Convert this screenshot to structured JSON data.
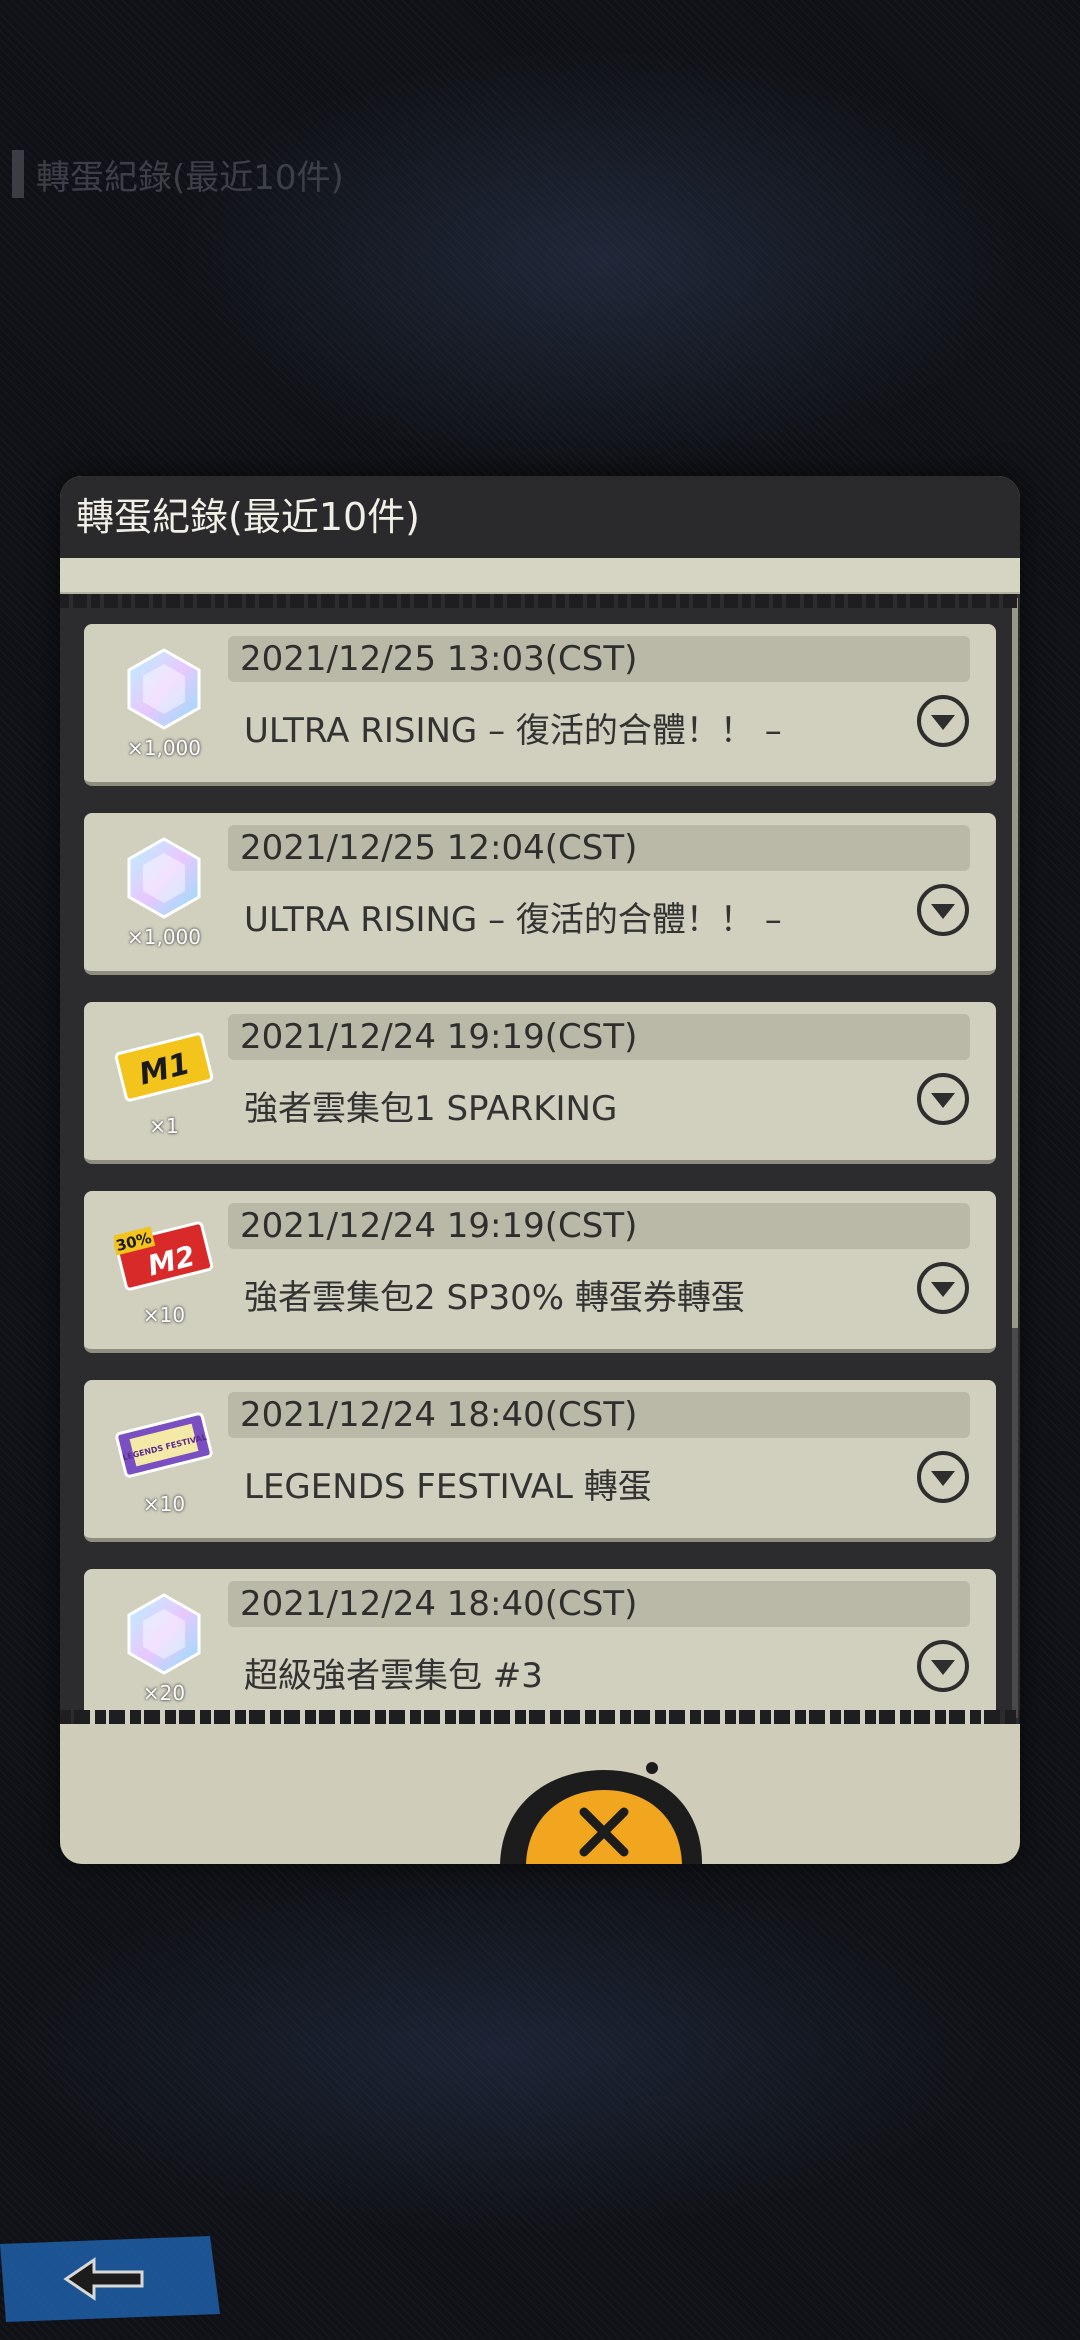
{
  "background_title": "轉蛋紀錄(最近10件)",
  "dialog": {
    "title": "轉蛋紀錄(最近10件)"
  },
  "records": [
    {
      "date": "2021/12/25 13:03(CST)",
      "name": "ULTRA RISING – 復活的合體！！ –",
      "qty": "×1,000",
      "icon": "chrono-crystal-icon"
    },
    {
      "date": "2021/12/25 12:04(CST)",
      "name": "ULTRA RISING – 復活的合體！！ –",
      "qty": "×1,000",
      "icon": "chrono-crystal-icon"
    },
    {
      "date": "2021/12/24 19:19(CST)",
      "name": "強者雲集包1 SPARKING",
      "qty": "×1",
      "icon": "m1-ticket-icon",
      "ticket_text": "M1"
    },
    {
      "date": "2021/12/24 19:19(CST)",
      "name": "強者雲集包2 SP30% 轉蛋券轉蛋",
      "qty": "×10",
      "icon": "m2-ticket-icon",
      "ticket_text": "M2",
      "ticket_badge": "30%"
    },
    {
      "date": "2021/12/24 18:40(CST)",
      "name": "LEGENDS FESTIVAL 轉蛋",
      "qty": "×10",
      "icon": "legends-festival-ticket-icon",
      "ticket_text": "LEGENDS FESTIVAL"
    },
    {
      "date": "2021/12/24 18:40(CST)",
      "name": "超級強者雲集包 #3",
      "qty": "×20",
      "icon": "chrono-crystal-icon"
    }
  ],
  "colors": {
    "dialog_bg": "#cfcdb9",
    "header_bg": "#2a2a2c",
    "close_accent": "#f2a51f"
  },
  "icons": {
    "close": "close-icon",
    "back": "back-arrow-icon",
    "expand": "chevron-down-circle-icon"
  }
}
